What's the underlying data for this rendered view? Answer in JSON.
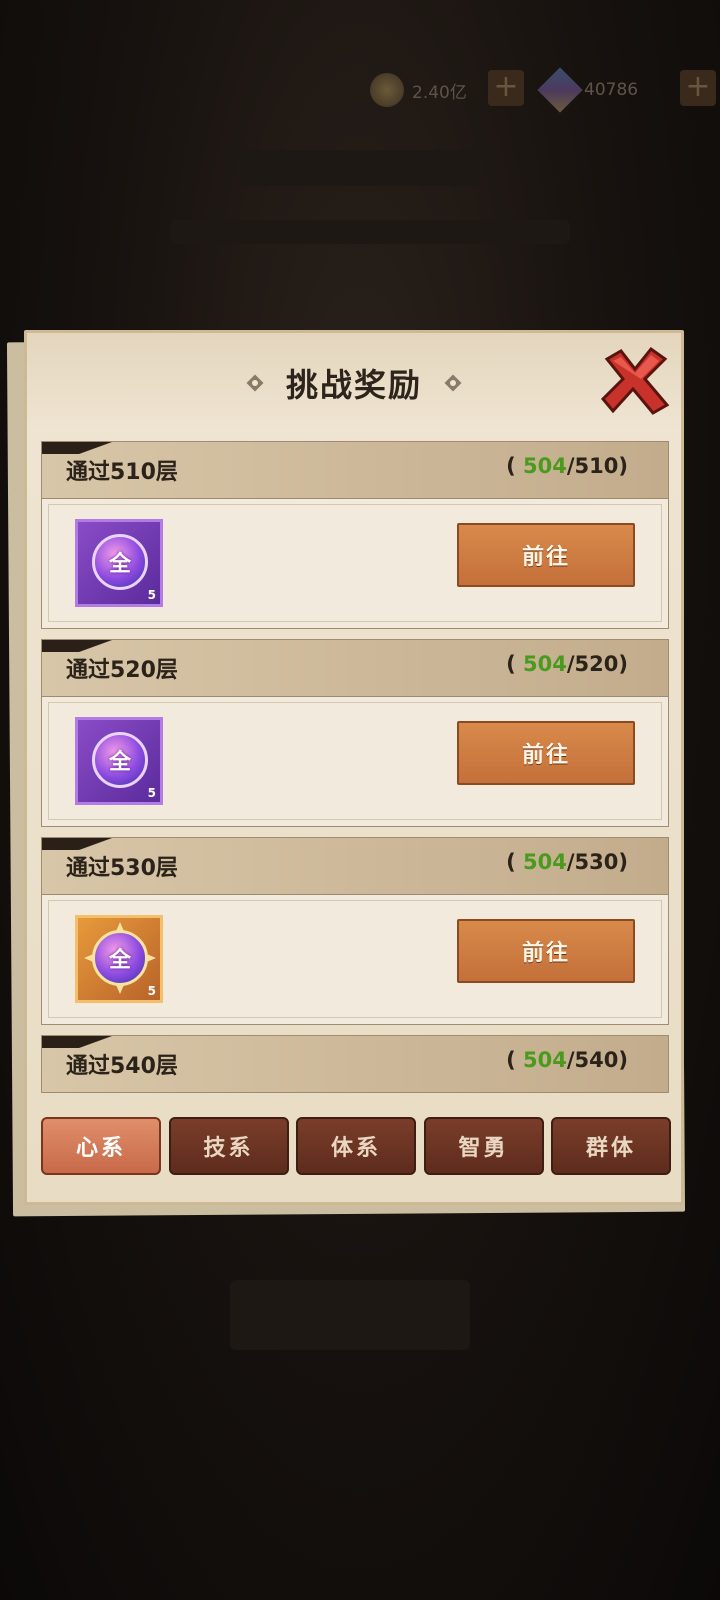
{
  "topbar": {
    "coins": "2.40亿",
    "gems": "40786",
    "coin_icon": "coin-icon",
    "gem_icon": "gem-icon"
  },
  "panel": {
    "title": "挑战奖励",
    "close_icon": "close-x-icon"
  },
  "rewards": [
    {
      "title": "通过510层",
      "current": "504",
      "target": "/510",
      "item_icon": "purple-all-orb-icon",
      "item_glyph": "全",
      "item_mark": "5",
      "button": "前往"
    },
    {
      "title": "通过520层",
      "current": "504",
      "target": "/520",
      "item_icon": "purple-all-orb-icon",
      "item_glyph": "全",
      "item_mark": "5",
      "button": "前往"
    },
    {
      "title": "通过530层",
      "current": "504",
      "target": "/530",
      "item_icon": "orange-all-compass-icon",
      "item_glyph": "全",
      "item_mark": "5",
      "button": "前往"
    },
    {
      "title": "通过540层",
      "current": "504",
      "target": "/540"
    }
  ],
  "progress_open": "(",
  "progress_close": ")",
  "tabs": [
    {
      "label": "心系",
      "active": true
    },
    {
      "label": "技系",
      "active": false
    },
    {
      "label": "体系",
      "active": false
    },
    {
      "label": "智勇",
      "active": false
    },
    {
      "label": "群体",
      "active": false
    }
  ],
  "colors": {
    "progress_current": "#4a9a1e",
    "button": "#c4703a",
    "tab_active": "#c86a4a",
    "tab_inactive": "#5e2c1d"
  }
}
